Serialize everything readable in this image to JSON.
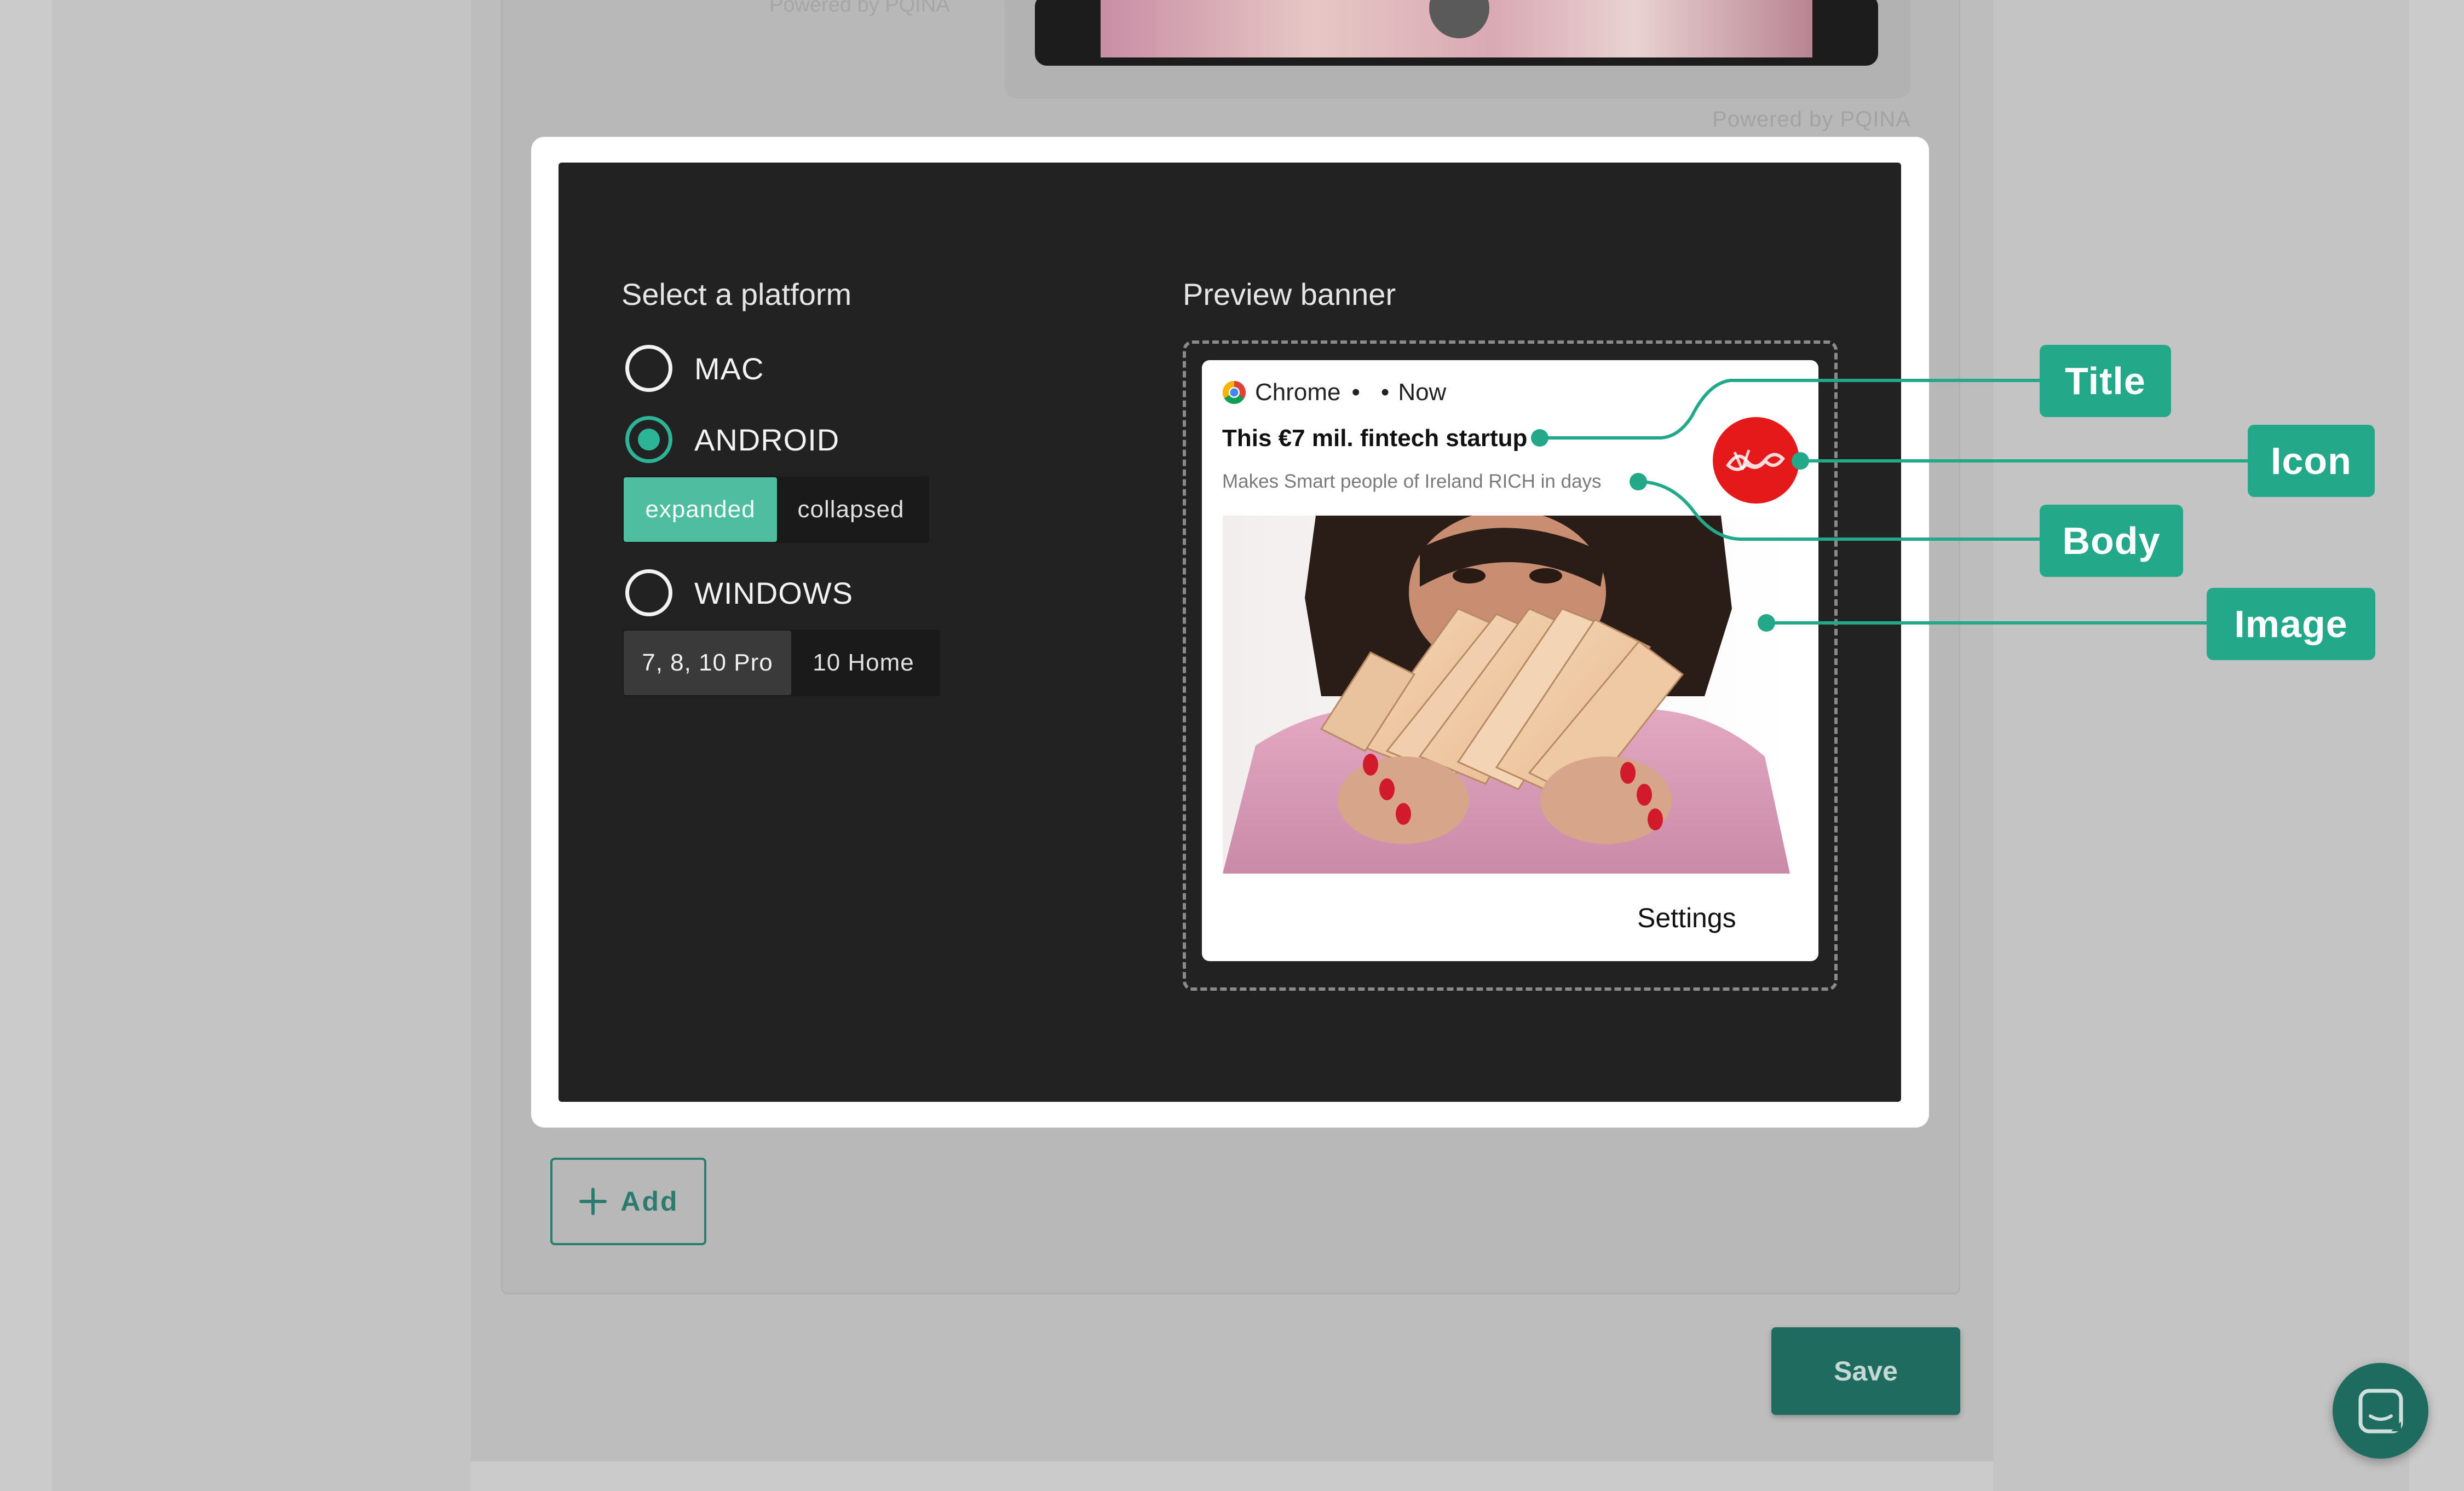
{
  "background": {
    "powered_by_top": "Powered by PQINA",
    "powered_by": "Powered by PQINA",
    "add_button": "Add",
    "save_button": "Save"
  },
  "modal": {
    "platform": {
      "title": "Select a platform",
      "options": [
        {
          "label": "MAC",
          "selected": false
        },
        {
          "label": "ANDROID",
          "selected": true
        },
        {
          "label": "WINDOWS",
          "selected": false
        }
      ],
      "android_modes": {
        "active": "expanded",
        "inactive": "collapsed"
      },
      "windows_modes": {
        "active": "7, 8, 10 Pro",
        "inactive": "10 Home"
      }
    },
    "preview": {
      "title": "Preview banner",
      "notification": {
        "app_name": "Chrome",
        "separator": "•",
        "time": "Now",
        "title": "This €7 mil. fintech startup",
        "body": "Makes Smart people of Ireland RICH in days",
        "action": "Settings"
      }
    }
  },
  "callouts": {
    "title": "Title",
    "icon": "Icon",
    "body": "Body",
    "image": "Image"
  },
  "colors": {
    "accent": "#23a98a",
    "modal_dark": "#222222",
    "save": "#1f6b5f"
  }
}
